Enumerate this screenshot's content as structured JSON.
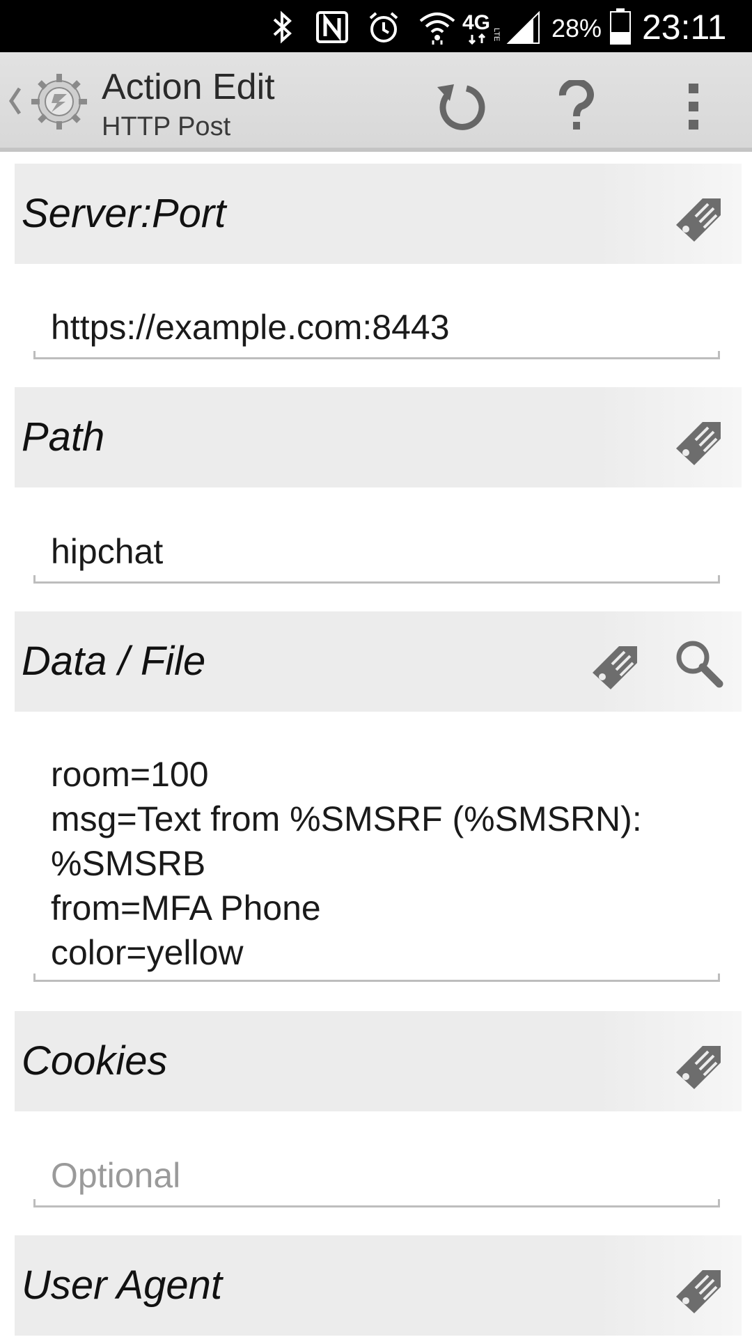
{
  "status_bar": {
    "battery_percent": "28%",
    "time": "23:11",
    "network_label": "4G",
    "icons": [
      "bluetooth-icon",
      "nfc-icon",
      "alarm-icon",
      "wifi-icon",
      "4g-lte-icon",
      "signal-icon",
      "battery-icon"
    ]
  },
  "action_bar": {
    "title": "Action Edit",
    "subtitle": "HTTP Post",
    "icons": [
      "back-chevron-icon",
      "tasker-app-icon",
      "revert-icon",
      "help-icon",
      "overflow-menu-icon"
    ]
  },
  "sections": {
    "server_port": {
      "title": "Server:Port",
      "value": "https://example.com:8443"
    },
    "path": {
      "title": "Path",
      "value": "hipchat"
    },
    "data_file": {
      "title": "Data / File",
      "value": "room=100\nmsg=Text from %SMSRF (%SMSRN):\n%SMSRB\nfrom=MFA Phone\ncolor=yellow"
    },
    "cookies": {
      "title": "Cookies",
      "placeholder": "Optional"
    },
    "user_agent": {
      "title": "User Agent"
    }
  },
  "colors": {
    "status_bar_bg": "#000000",
    "action_bar_bg": "#dcdcdc",
    "section_header_bg": "#ececec",
    "field_underline": "#bdbdbd"
  }
}
